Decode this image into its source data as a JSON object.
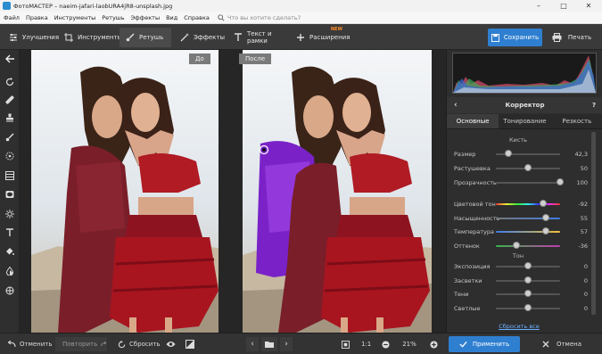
{
  "window": {
    "title": "ФотоМАСТЕР – naeim-jafari-laobURA4jR8-unsplash.jpg",
    "minimize": "–",
    "maximize": "□",
    "close": "✕"
  },
  "menu": {
    "items": [
      "Файл",
      "Правка",
      "Инструменты",
      "Ретушь",
      "Эффекты",
      "Вид",
      "Справка"
    ],
    "search_placeholder": "Что вы хотите сделать?"
  },
  "toolbar": {
    "tabs": [
      {
        "label": "Улучшения",
        "icon": "sliders-icon"
      },
      {
        "label": "Инструменты",
        "icon": "crop-icon"
      },
      {
        "label": "Ретушь",
        "icon": "brush-icon",
        "active": true
      },
      {
        "label": "Эффекты",
        "icon": "magic-wand-icon"
      },
      {
        "label": "Текст и рамки",
        "icon": "text-icon"
      },
      {
        "label": "Расширения",
        "icon": "plus-icon",
        "badge": "NEW"
      }
    ],
    "save_label": "Сохранить",
    "print_label": "Печать"
  },
  "canvas": {
    "before_label": "До",
    "after_label": "После"
  },
  "panel": {
    "title": "Корректор",
    "help": "?",
    "subtabs": [
      "Основные",
      "Тонирование",
      "Резкость"
    ],
    "brush_section": "Кисть",
    "tone_section": "Тон",
    "brush": [
      {
        "label": "Размер",
        "value": "42,3",
        "level": 0.2
      },
      {
        "label": "Растушевка",
        "value": "50",
        "level": 0.5
      },
      {
        "label": "Прозрачность",
        "value": "100",
        "level": 1.0
      }
    ],
    "color": [
      {
        "label": "Цветовой тон",
        "value": "-92",
        "level": 0.74
      },
      {
        "label": "Насыщенность",
        "value": "55",
        "level": 0.78
      },
      {
        "label": "Температура",
        "value": "57",
        "level": 0.78
      },
      {
        "label": "Оттенок",
        "value": "-36",
        "level": 0.32
      }
    ],
    "tone": [
      {
        "label": "Экспозиция",
        "value": "0",
        "level": 0.5
      },
      {
        "label": "Засветки",
        "value": "0",
        "level": 0.5
      },
      {
        "label": "Тени",
        "value": "0",
        "level": 0.5
      },
      {
        "label": "Светлые",
        "value": "0",
        "level": 0.5
      }
    ],
    "reset_all": "Сбросить все"
  },
  "bottom": {
    "undo": "Отменить",
    "redo": "Повторить",
    "reset": "Сбросить",
    "zoom_1to1": "1:1",
    "zoom_value": "21%",
    "apply": "Применить",
    "cancel": "Отмена"
  },
  "colors": {
    "accent": "#2f7fd0",
    "badge_new": "#ff8a2a",
    "dress_red": "#a8151f",
    "recolored_purple": "#7a22c8"
  }
}
